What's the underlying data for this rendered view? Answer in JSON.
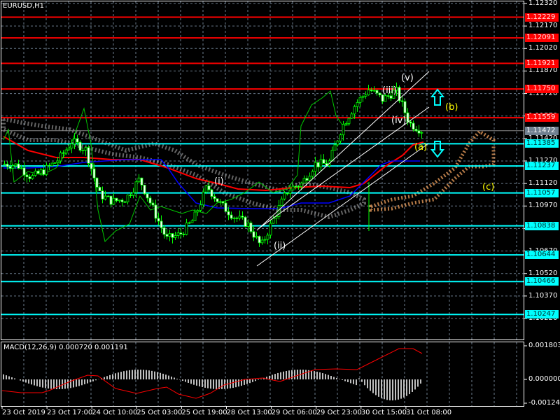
{
  "symbol_title": "EURUSD,H1",
  "macd_title": "MACD(12,26,9) 0.000720 0.001191",
  "price_axis": [
    "1.12320",
    "1.12170",
    "1.12020",
    "1.11870",
    "1.11720",
    "1.11570",
    "1.11420",
    "1.11270",
    "1.11120",
    "1.10970",
    "1.10820",
    "1.10670",
    "1.10520",
    "1.10370",
    "1.10220"
  ],
  "levels": [
    {
      "price": 1.12229,
      "label": "1.12229",
      "color": "#ff0000"
    },
    {
      "price": 1.12091,
      "label": "1.12091",
      "color": "#ff0000"
    },
    {
      "price": 1.11921,
      "label": "1.11921",
      "color": "#ff0000"
    },
    {
      "price": 1.1175,
      "label": "1.11750",
      "color": "#ff0000"
    },
    {
      "price": 1.11559,
      "label": "1.11559",
      "color": "#ff0000"
    },
    {
      "price": 1.11385,
      "label": "1.11385",
      "color": "#00ffff"
    },
    {
      "price": 1.11237,
      "label": "1.11237",
      "color": "#00ffff"
    },
    {
      "price": 1.11057,
      "label": "1.11057",
      "color": "#00ffff"
    },
    {
      "price": 1.10838,
      "label": "1.10838",
      "color": "#00ffff"
    },
    {
      "price": 1.10644,
      "label": "1.10644",
      "color": "#00ffff"
    },
    {
      "price": 1.10466,
      "label": "1.10466",
      "color": "#00ffff"
    },
    {
      "price": 1.10247,
      "label": "1.10247",
      "color": "#00ffff"
    }
  ],
  "current_price": {
    "price": 1.11472,
    "label": "1.11472",
    "color": "#708090"
  },
  "macd_axis": [
    "0.001803",
    "0.000000",
    "-0.001245"
  ],
  "time_axis": [
    "23 Oct 2019",
    "23 Oct 17:00",
    "24 Oct 10:00",
    "25 Oct 03:00",
    "25 Oct 19:00",
    "28 Oct 13:00",
    "29 Oct 06:00",
    "29 Oct 23:00",
    "30 Oct 15:00",
    "31 Oct 08:00"
  ],
  "waves": {
    "i": "(i)",
    "ii": "(ii)",
    "iii": "(iii)",
    "iv": "(iv)",
    "v": "(v)",
    "a": "(a)",
    "b": "(b)",
    "c": "(c)"
  },
  "price_path": [
    [
      1.1125,
      1.1124,
      1.1116,
      1.1121,
      1.1128,
      1.114,
      1.1135,
      1.1105,
      1.11,
      1.1102,
      1.1115,
      1.1095,
      1.1075,
      1.1078,
      1.1088,
      1.111,
      1.1098,
      1.109,
      1.1085,
      1.107,
      1.109,
      1.1108,
      1.1112,
      1.1125,
      1.1125,
      1.115,
      1.1165,
      1.1175,
      1.1168,
      1.1174,
      1.1152,
      1.1147
    ]
  ]
}
